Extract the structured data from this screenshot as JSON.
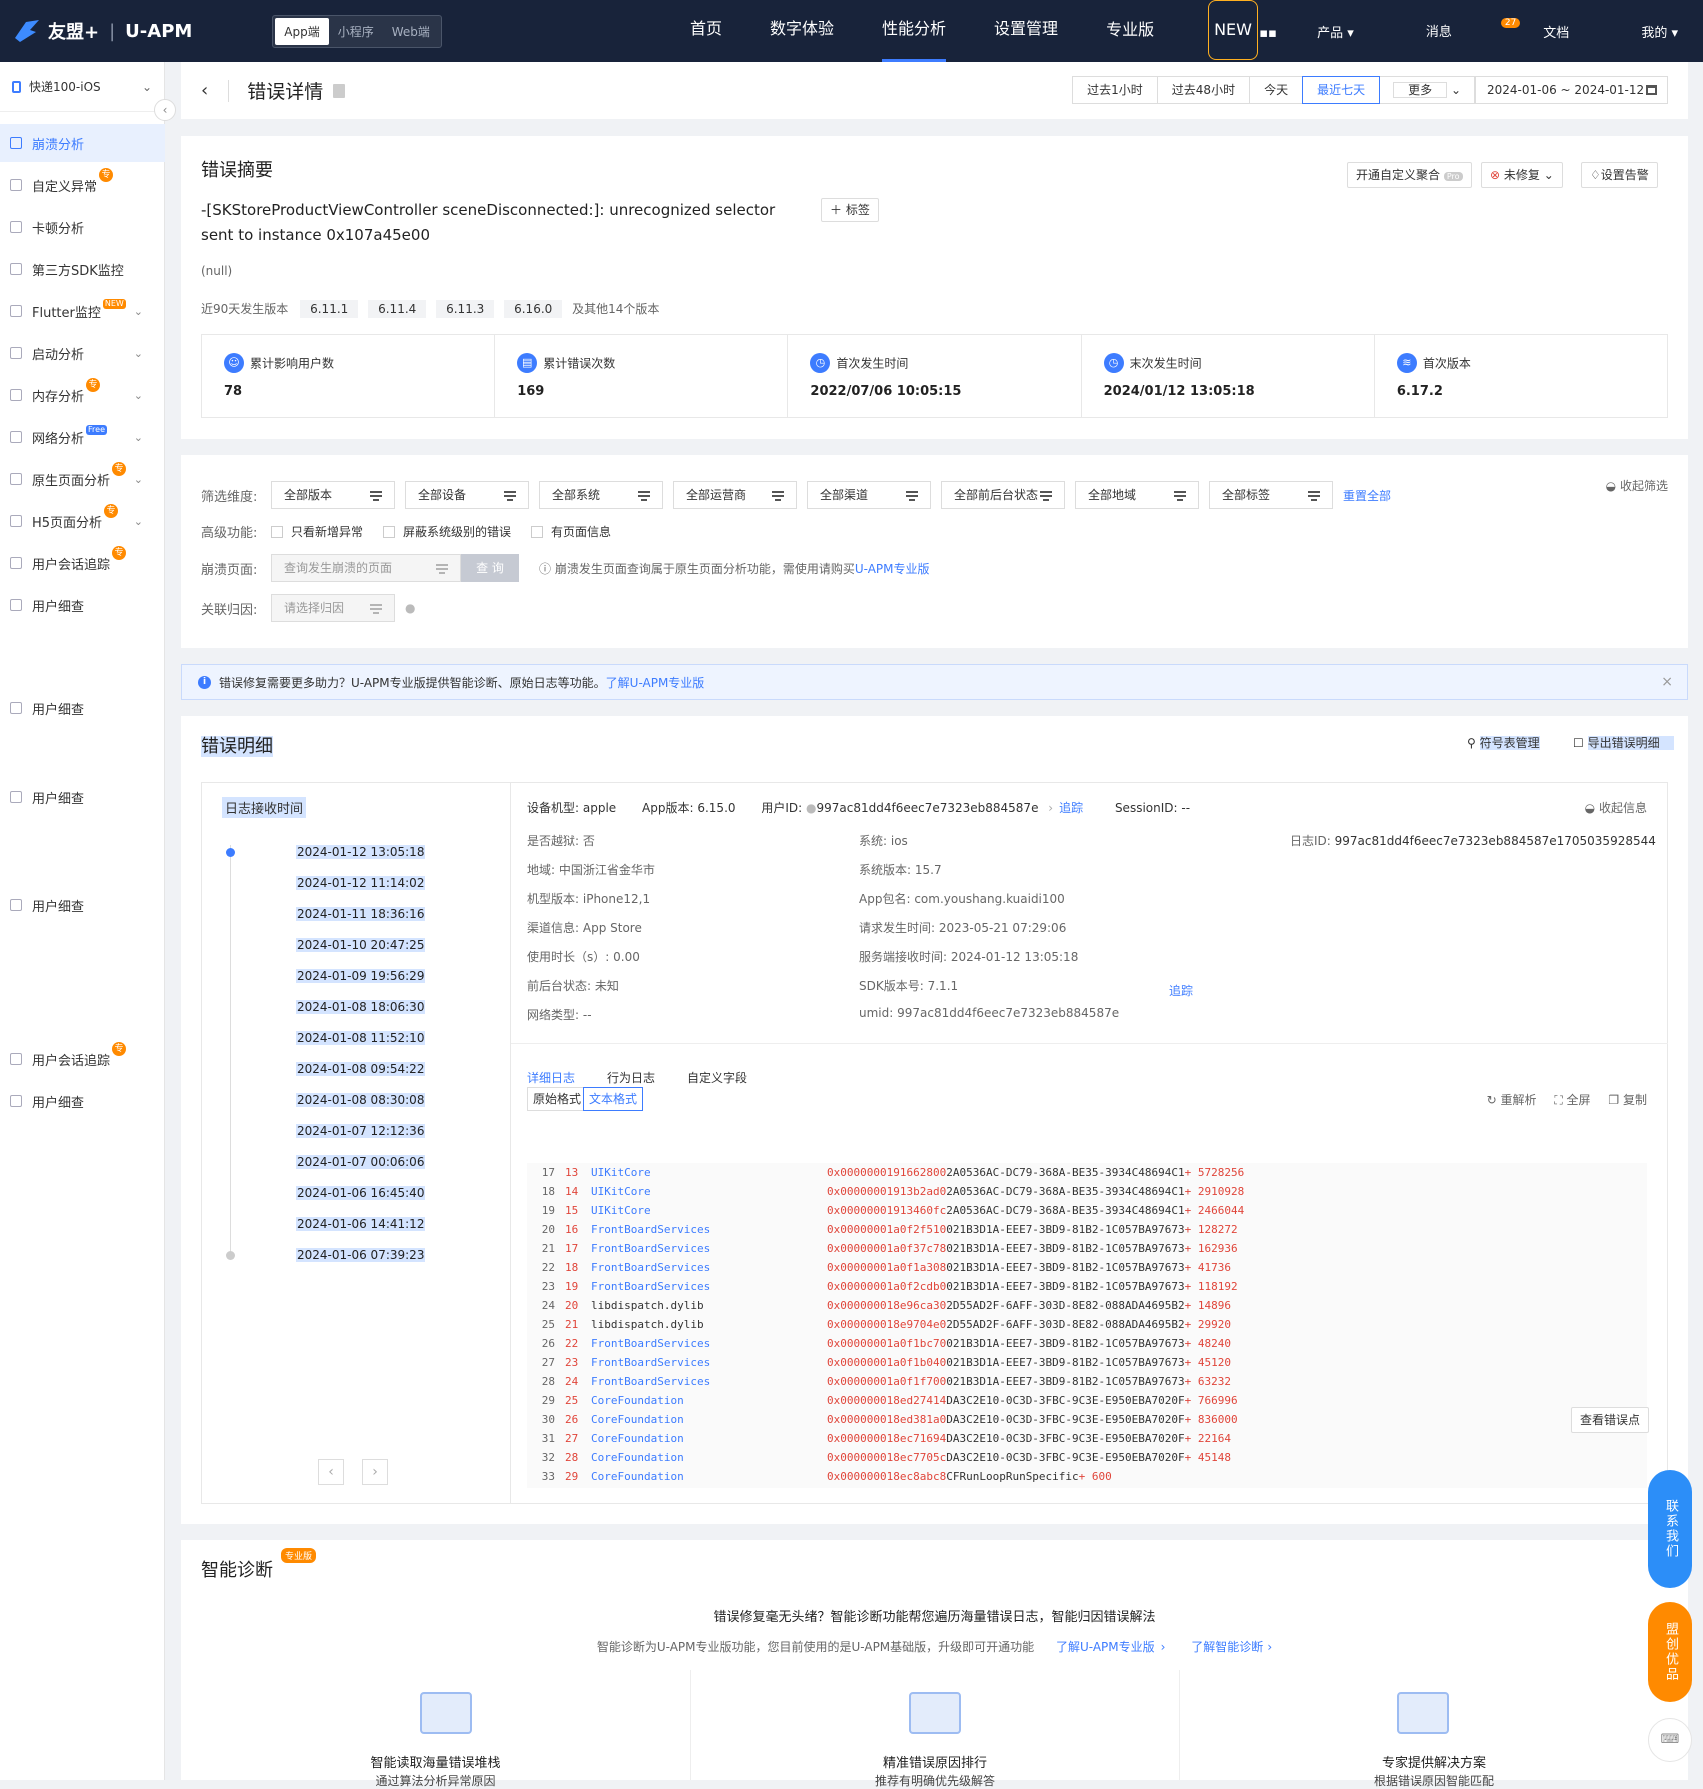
{
  "topbar": {
    "brand": "友盟+",
    "product": "U-APM",
    "platform_tabs": [
      "App端",
      "小程序",
      "Web端"
    ],
    "nav": [
      "首页",
      "数字体验",
      "性能分析",
      "设置管理"
    ],
    "pro_label": "专业版",
    "new_badge": "NEW",
    "products": "产品",
    "messages": "消息",
    "msg_count": "27",
    "docs": "文档",
    "me": "我的"
  },
  "sidebar": {
    "app_name": "快递100-iOS",
    "items": [
      {
        "label": "崩溃分析",
        "active": true
      },
      {
        "label": "自定义异常",
        "tag": "专"
      },
      {
        "label": "卡顿分析"
      },
      {
        "label": "第三方SDK监控"
      },
      {
        "label": "Flutter监控",
        "ntag": "NEW",
        "arrow": true
      },
      {
        "label": "启动分析",
        "arrow": true
      },
      {
        "label": "内存分析",
        "tag": "专",
        "arrow": true
      },
      {
        "label": "网络分析",
        "ftag": "Free",
        "arrow": true
      },
      {
        "label": "原生页面分析",
        "tag": "专",
        "arrow": true
      },
      {
        "label": "H5页面分析",
        "tag": "专",
        "arrow": true
      },
      {
        "label": "用户会话追踪",
        "tag": "专"
      },
      {
        "label": "用户细查"
      },
      {
        "label": "用户细查"
      },
      {
        "label": "用户细查"
      },
      {
        "label": "用户细查"
      },
      {
        "label": "用户会话追踪",
        "tag": "专"
      },
      {
        "label": "用户细查"
      }
    ]
  },
  "header": {
    "title": "错误详情",
    "ranges": [
      "过去1小时",
      "过去48小时",
      "今天",
      "最近七天",
      "更多"
    ],
    "active_range": "最近七天",
    "date_range": "2024-01-06 ~ 2024-01-12"
  },
  "summary": {
    "title": "错误摘要",
    "btn_aggregate": "开通自定义聚合",
    "pro_mini": "Pro",
    "btn_status": "未修复",
    "btn_alert": "设置告警",
    "message": "-[SKStoreProductViewController sceneDisconnected:]: unrecognized selector sent to instance 0x107a45e00",
    "add_tag": "标签",
    "null_text": "(null)",
    "versions_label": "近90天发生版本",
    "versions": [
      "6.11.1",
      "6.11.4",
      "6.11.3",
      "6.16.0"
    ],
    "versions_more": "及其他14个版本",
    "stats": [
      {
        "label": "累计影响用户数",
        "value": "78"
      },
      {
        "label": "累计错误次数",
        "value": "169"
      },
      {
        "label": "首次发生时间",
        "value": "2022/07/06 10:05:15"
      },
      {
        "label": "末次发生时间",
        "value": "2024/01/12 13:05:18"
      },
      {
        "label": "首次版本",
        "value": "6.17.2"
      }
    ]
  },
  "filters": {
    "dim_label": "筛选维度:",
    "selects": [
      "全部版本",
      "全部设备",
      "全部系统",
      "全部运营商",
      "全部渠道",
      "全部前后台状态",
      "全部地域",
      "全部标签"
    ],
    "reset": "重置全部",
    "collapse": "收起筛选",
    "adv_label": "高级功能:",
    "adv_options": [
      "只看新增异常",
      "屏蔽系统级别的错误",
      "有页面信息"
    ],
    "page_label": "崩溃页面:",
    "page_placeholder": "查询发生崩溃的页面",
    "query_btn": "查 询",
    "page_note": "崩溃发生页面查询属于原生页面分析功能，需使用请购买",
    "page_note_link": "U-APM专业版",
    "attr_label": "关联归因:",
    "attr_placeholder": "请选择归因"
  },
  "banner": {
    "text": "错误修复需要更多助力？U-APM专业版提供智能诊断、原始日志等功能。",
    "link": "了解U-APM专业版"
  },
  "detail": {
    "title": "错误明细",
    "symbols": "符号表管理",
    "export": "导出错误明细",
    "timeline_title": "日志接收时间",
    "timeline": [
      "2024-01-12 13:05:18",
      "2024-01-12 11:14:02",
      "2024-01-11 18:36:16",
      "2024-01-10 20:47:25",
      "2024-01-09 19:56:29",
      "2024-01-08 18:06:30",
      "2024-01-08 11:52:10",
      "2024-01-08 09:54:22",
      "2024-01-08 08:30:08",
      "2024-01-07 12:12:36",
      "2024-01-07 00:06:06",
      "2024-01-06 16:45:40",
      "2024-01-06 14:41:12",
      "2024-01-06 07:39:23"
    ],
    "device_model_label": "设备机型:",
    "device_model": "apple",
    "app_ver_label": "App版本:",
    "app_ver": "6.15.0",
    "uid_label": "用户ID:",
    "uid": "997ac81dd4f6eec7e7323eb884587e",
    "trace": "追踪",
    "session_label": "SessionID:",
    "session": "--",
    "collapse_info": "收起信息",
    "col1": [
      [
        "是否越狱:",
        "否"
      ],
      [
        "地域:",
        "中国浙江省金华市"
      ],
      [
        "机型版本:",
        "iPhone12,1"
      ],
      [
        "渠道信息:",
        "App Store"
      ],
      [
        "使用时长（s）:",
        "0.00"
      ],
      [
        "前后台状态:",
        "未知"
      ],
      [
        "网络类型:",
        "--"
      ]
    ],
    "col2": [
      [
        "系统:",
        "ios"
      ],
      [
        "系统版本:",
        "15.7"
      ],
      [
        "App包名:",
        "com.youshang.kuaidi100"
      ],
      [
        "请求发生时间:",
        "2023-05-21 07:29:06"
      ],
      [
        "服务端接收时间:",
        "2024-01-12 13:05:18"
      ],
      [
        "SDK版本号:",
        "7.1.1"
      ],
      [
        "umid:",
        "997ac81dd4f6eec7e7323eb884587e"
      ]
    ],
    "log_id_label": "日志ID:",
    "log_id": "997ac81dd4f6eec7e7323eb884587e1705035928544",
    "tabs": [
      "详细日志",
      "行为日志",
      "自定义字段"
    ],
    "formats": [
      "原始格式",
      "文本格式"
    ],
    "tools": [
      "重解析",
      "全屏",
      "复制"
    ],
    "view_point": "查看错误点",
    "log_lines": [
      [
        "17",
        "13",
        "UIKitCore",
        "0x0000000191662800",
        "2A0536AC-DC79-368A-BE35-3934C48694C1",
        "+ 5728256"
      ],
      [
        "18",
        "14",
        "UIKitCore",
        "0x00000001913b2ad0",
        "2A0536AC-DC79-368A-BE35-3934C48694C1",
        "+ 2910928"
      ],
      [
        "19",
        "15",
        "UIKitCore",
        "0x00000001913460fc",
        "2A0536AC-DC79-368A-BE35-3934C48694C1",
        "+ 2466044"
      ],
      [
        "20",
        "16",
        "FrontBoardServices",
        "0x00000001a0f2f510",
        "021B3D1A-EEE7-3BD9-81B2-1C057BA97673",
        "+ 128272"
      ],
      [
        "21",
        "17",
        "FrontBoardServices",
        "0x00000001a0f37c78",
        "021B3D1A-EEE7-3BD9-81B2-1C057BA97673",
        "+ 162936"
      ],
      [
        "22",
        "18",
        "FrontBoardServices",
        "0x00000001a0f1a308",
        "021B3D1A-EEE7-3BD9-81B2-1C057BA97673",
        "+ 41736"
      ],
      [
        "23",
        "19",
        "FrontBoardServices",
        "0x00000001a0f2cdb0",
        "021B3D1A-EEE7-3BD9-81B2-1C057BA97673",
        "+ 118192"
      ],
      [
        "24",
        "20",
        "libdispatch.dylib",
        "0x000000018e96ca30",
        "2D55AD2F-6AFF-303D-8E82-088ADA4695B2",
        "+ 14896"
      ],
      [
        "25",
        "21",
        "libdispatch.dylib",
        "0x000000018e9704e0",
        "2D55AD2F-6AFF-303D-8E82-088ADA4695B2",
        "+ 29920"
      ],
      [
        "26",
        "22",
        "FrontBoardServices",
        "0x00000001a0f1bc70",
        "021B3D1A-EEE7-3BD9-81B2-1C057BA97673",
        "+ 48240"
      ],
      [
        "27",
        "23",
        "FrontBoardServices",
        "0x00000001a0f1b040",
        "021B3D1A-EEE7-3BD9-81B2-1C057BA97673",
        "+ 45120"
      ],
      [
        "28",
        "24",
        "FrontBoardServices",
        "0x00000001a0f1f700",
        "021B3D1A-EEE7-3BD9-81B2-1C057BA97673",
        "+ 63232"
      ],
      [
        "29",
        "25",
        "CoreFoundation",
        "0x000000018ed27414",
        "DA3C2E10-0C3D-3FBC-9C3E-E950EBA7020F",
        "+ 766996"
      ],
      [
        "30",
        "26",
        "CoreFoundation",
        "0x000000018ed381a0",
        "DA3C2E10-0C3D-3FBC-9C3E-E950EBA7020F",
        "+ 836000"
      ],
      [
        "31",
        "27",
        "CoreFoundation",
        "0x000000018ec71694",
        "DA3C2E10-0C3D-3FBC-9C3E-E950EBA7020F",
        "+ 22164"
      ],
      [
        "32",
        "28",
        "CoreFoundation",
        "0x000000018ec7705c",
        "DA3C2E10-0C3D-3FBC-9C3E-E950EBA7020F",
        "+ 45148"
      ],
      [
        "33",
        "29",
        "CoreFoundation",
        "0x000000018ec8abc8",
        "CFRunLoopRunSpecific",
        "+ 600"
      ]
    ]
  },
  "diagnosis": {
    "title": "智能诊断",
    "pro_tag": "专业版",
    "headline": "错误修复毫无头绪？智能诊断功能帮您遍历海量错误日志，智能归因错误解法",
    "sub": "智能诊断为U-APM专业版功能，您目前使用的是U-APM基础版，升级即可开通功能",
    "link1": "了解U-APM专业版",
    "link2": "了解智能诊断",
    "features": [
      "智能读取海量错误堆栈",
      "精准错误原因排行",
      "专家提供解决方案"
    ],
    "feature_subs": [
      "通过算法分析异常原因",
      "推荐有明确优先级解答",
      "根据错误原因智能匹配"
    ]
  },
  "float": {
    "contact": "联系我们",
    "coop": "盟创优品"
  }
}
